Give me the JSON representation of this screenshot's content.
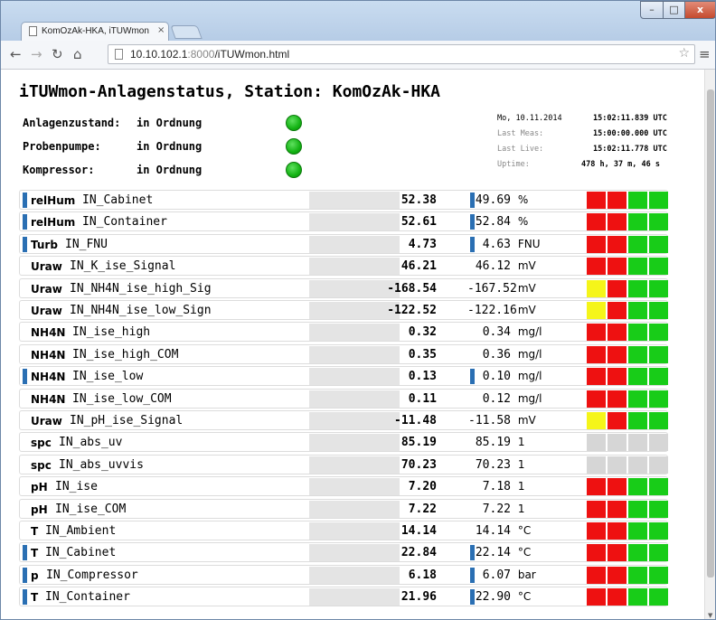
{
  "colors": {
    "red": "#ee1111",
    "green": "#18cc18",
    "yellow": "#f5f51a",
    "gray": "#d6d6d6",
    "indicator": "#2a6fb3"
  },
  "browser": {
    "tab_title": "KomOzAk-HKA, iTUWmon",
    "tab_close": "×",
    "url_host": "10.10.102.1",
    "url_port": ":8000",
    "url_path": "/iTUWmon.html",
    "window_buttons": {
      "minimize": "–",
      "maximize": "□",
      "close": "x"
    },
    "icons": [
      "back-arrow-icon",
      "forward-arrow-icon",
      "reload-icon",
      "home-icon",
      "page-icon",
      "star-icon",
      "menu-icon"
    ]
  },
  "page": {
    "title": "iTUWmon-Anlagenstatus, Station: KomOzAk-HKA",
    "status": [
      {
        "label": "Anlagenzustand:",
        "value": "in Ordnung",
        "lamp": "green"
      },
      {
        "label": "Probenpumpe:",
        "value": "in Ordnung",
        "lamp": "green"
      },
      {
        "label": "Kompressor:",
        "value": "in Ordnung",
        "lamp": "green"
      }
    ],
    "info": {
      "date": "Mo, 10.11.2014",
      "date_time": "15:02:11.839 UTC",
      "last_meas_label": "Last Meas:",
      "last_meas": "15:00:00.000 UTC",
      "last_live_label": "Last Live:",
      "last_live": "15:02:11.778 UTC",
      "uptime_label": "Uptime:",
      "uptime": "478 h,  37 m,  46 s"
    },
    "rows": [
      {
        "name": "relHum",
        "channel": "IN_Cabinet",
        "value": "52.38",
        "live": "49.69",
        "unit": "%",
        "ind1": true,
        "ind2": true,
        "lamps": [
          "red",
          "red",
          "green",
          "green"
        ]
      },
      {
        "name": "relHum",
        "channel": "IN_Container",
        "value": "52.61",
        "live": "52.84",
        "unit": "%",
        "ind1": true,
        "ind2": true,
        "lamps": [
          "red",
          "red",
          "green",
          "green"
        ]
      },
      {
        "name": "Turb",
        "channel": "IN_FNU",
        "value": "4.73",
        "live": "4.63",
        "unit": "FNU",
        "ind1": true,
        "ind2": true,
        "lamps": [
          "red",
          "red",
          "green",
          "green"
        ]
      },
      {
        "name": "Uraw",
        "channel": "IN_K_ise_Signal",
        "value": "46.21",
        "live": "46.12",
        "unit": "mV",
        "ind1": false,
        "ind2": false,
        "lamps": [
          "red",
          "red",
          "green",
          "green"
        ]
      },
      {
        "name": "Uraw",
        "channel": "IN_NH4N_ise_high_Sig",
        "value": "-168.54",
        "live": "-167.52",
        "unit": "mV",
        "ind1": false,
        "ind2": false,
        "lamps": [
          "yellow",
          "red",
          "green",
          "green"
        ]
      },
      {
        "name": "Uraw",
        "channel": "IN_NH4N_ise_low_Sign",
        "value": "-122.52",
        "live": "-122.16",
        "unit": "mV",
        "ind1": false,
        "ind2": false,
        "lamps": [
          "yellow",
          "red",
          "green",
          "green"
        ]
      },
      {
        "name": "NH4N",
        "channel": "IN_ise_high",
        "value": "0.32",
        "live": "0.34",
        "unit": "mg/l",
        "ind1": false,
        "ind2": false,
        "lamps": [
          "red",
          "red",
          "green",
          "green"
        ]
      },
      {
        "name": "NH4N",
        "channel": "IN_ise_high_COM",
        "value": "0.35",
        "live": "0.36",
        "unit": "mg/l",
        "ind1": false,
        "ind2": false,
        "lamps": [
          "red",
          "red",
          "green",
          "green"
        ]
      },
      {
        "name": "NH4N",
        "channel": "IN_ise_low",
        "value": "0.13",
        "live": "0.10",
        "unit": "mg/l",
        "ind1": true,
        "ind2": true,
        "lamps": [
          "red",
          "red",
          "green",
          "green"
        ]
      },
      {
        "name": "NH4N",
        "channel": "IN_ise_low_COM",
        "value": "0.11",
        "live": "0.12",
        "unit": "mg/l",
        "ind1": false,
        "ind2": false,
        "lamps": [
          "red",
          "red",
          "green",
          "green"
        ]
      },
      {
        "name": "Uraw",
        "channel": "IN_pH_ise_Signal",
        "value": "-11.48",
        "live": "-11.58",
        "unit": "mV",
        "ind1": false,
        "ind2": false,
        "lamps": [
          "yellow",
          "red",
          "green",
          "green"
        ]
      },
      {
        "name": "spc",
        "channel": "IN_abs_uv",
        "value": "85.19",
        "live": "85.19",
        "unit": "1",
        "ind1": false,
        "ind2": false,
        "lamps": [
          "gray",
          "gray",
          "gray",
          "gray"
        ]
      },
      {
        "name": "spc",
        "channel": "IN_abs_uvvis",
        "value": "70.23",
        "live": "70.23",
        "unit": "1",
        "ind1": false,
        "ind2": false,
        "lamps": [
          "gray",
          "gray",
          "gray",
          "gray"
        ]
      },
      {
        "name": "pH",
        "channel": "IN_ise",
        "value": "7.20",
        "live": "7.18",
        "unit": "1",
        "ind1": false,
        "ind2": false,
        "lamps": [
          "red",
          "red",
          "green",
          "green"
        ]
      },
      {
        "name": "pH",
        "channel": "IN_ise_COM",
        "value": "7.22",
        "live": "7.22",
        "unit": "1",
        "ind1": false,
        "ind2": false,
        "lamps": [
          "red",
          "red",
          "green",
          "green"
        ]
      },
      {
        "name": "T",
        "channel": "IN_Ambient",
        "value": "14.14",
        "live": "14.14",
        "unit": "°C",
        "ind1": false,
        "ind2": false,
        "lamps": [
          "red",
          "red",
          "green",
          "green"
        ]
      },
      {
        "name": "T",
        "channel": "IN_Cabinet",
        "value": "22.84",
        "live": "22.14",
        "unit": "°C",
        "ind1": true,
        "ind2": true,
        "lamps": [
          "red",
          "red",
          "green",
          "green"
        ]
      },
      {
        "name": "p",
        "channel": "IN_Compressor",
        "value": "6.18",
        "live": "6.07",
        "unit": "bar",
        "ind1": true,
        "ind2": true,
        "lamps": [
          "red",
          "red",
          "green",
          "green"
        ]
      },
      {
        "name": "T",
        "channel": "IN_Container",
        "value": "21.96",
        "live": "22.90",
        "unit": "°C",
        "ind1": true,
        "ind2": true,
        "lamps": [
          "red",
          "red",
          "green",
          "green"
        ]
      }
    ]
  }
}
